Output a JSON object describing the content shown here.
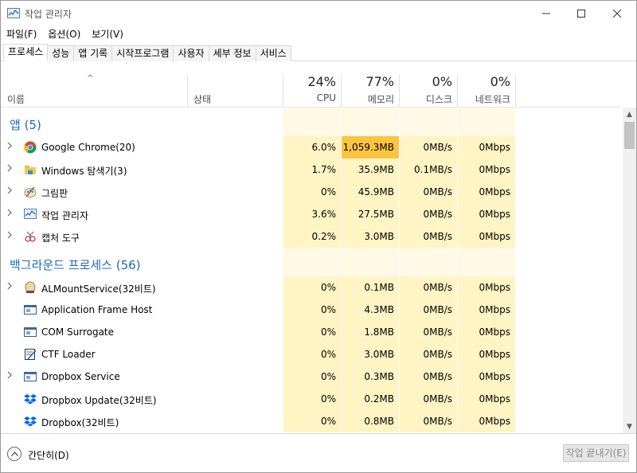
{
  "window": {
    "title": "작업 관리자",
    "controls": {
      "minimize": "—",
      "maximize": "☐",
      "close": "✕"
    }
  },
  "menu": [
    "파일(F)",
    "옵션(O)",
    "보기(V)"
  ],
  "tabs": [
    "프로세스",
    "성능",
    "앱 기록",
    "시작프로그램",
    "사용자",
    "세부 정보",
    "서비스"
  ],
  "active_tab": "프로세스",
  "columns": {
    "name": "이름",
    "status": "상태",
    "cpu": {
      "percent": "24%",
      "label": "CPU"
    },
    "memory": {
      "percent": "77%",
      "label": "메모리"
    },
    "disk": {
      "percent": "0%",
      "label": "디스크"
    },
    "network": {
      "percent": "0%",
      "label": "네트워크"
    }
  },
  "groups": [
    {
      "title": "앱 (5)",
      "rows": [
        {
          "name": "Google Chrome(20)",
          "icon": "chrome-icon",
          "expandable": true,
          "cpu": "6.0%",
          "memory": "1,059.3MB",
          "disk": "0MB/s",
          "network": "0Mbps",
          "memory_highlight": true
        },
        {
          "name": "Windows 탐색기(3)",
          "icon": "folder-icon",
          "expandable": true,
          "cpu": "1.7%",
          "memory": "35.9MB",
          "disk": "0.1MB/s",
          "network": "0Mbps"
        },
        {
          "name": "그림판",
          "icon": "paint-icon",
          "expandable": true,
          "cpu": "0%",
          "memory": "45.9MB",
          "disk": "0MB/s",
          "network": "0Mbps"
        },
        {
          "name": "작업 관리자",
          "icon": "task-manager-icon",
          "expandable": true,
          "cpu": "3.6%",
          "memory": "27.5MB",
          "disk": "0MB/s",
          "network": "0Mbps"
        },
        {
          "name": "캡처 도구",
          "icon": "snipping-tool-icon",
          "expandable": true,
          "cpu": "0.2%",
          "memory": "3.0MB",
          "disk": "0MB/s",
          "network": "0Mbps"
        }
      ]
    },
    {
      "title": "백그라운드 프로세스 (56)",
      "rows": [
        {
          "name": "ALMountService(32비트)",
          "icon": "almount-icon",
          "expandable": true,
          "cpu": "0%",
          "memory": "0.1MB",
          "disk": "0MB/s",
          "network": "0Mbps"
        },
        {
          "name": "Application Frame Host",
          "icon": "app-frame-icon",
          "expandable": false,
          "cpu": "0%",
          "memory": "4.3MB",
          "disk": "0MB/s",
          "network": "0Mbps"
        },
        {
          "name": "COM Surrogate",
          "icon": "app-frame-icon",
          "expandable": false,
          "cpu": "0%",
          "memory": "1.8MB",
          "disk": "0MB/s",
          "network": "0Mbps"
        },
        {
          "name": "CTF Loader",
          "icon": "ctf-icon",
          "expandable": false,
          "cpu": "0%",
          "memory": "3.0MB",
          "disk": "0MB/s",
          "network": "0Mbps"
        },
        {
          "name": "Dropbox Service",
          "icon": "app-frame-icon",
          "expandable": true,
          "cpu": "0%",
          "memory": "0.3MB",
          "disk": "0MB/s",
          "network": "0Mbps"
        },
        {
          "name": "Dropbox Update(32비트)",
          "icon": "dropbox-icon",
          "expandable": false,
          "cpu": "0%",
          "memory": "0.2MB",
          "disk": "0MB/s",
          "network": "0Mbps"
        },
        {
          "name": "Dropbox(32비트)",
          "icon": "dropbox-icon",
          "expandable": false,
          "cpu": "0%",
          "memory": "0.8MB",
          "disk": "0MB/s",
          "network": "0Mbps"
        }
      ]
    }
  ],
  "footer": {
    "fewer_details": "간단히(D)",
    "end_task": "작업 끝내기(E)"
  },
  "colors": {
    "heat_light": "#fff9e5",
    "heat_mid": "#fff4c4",
    "heat_high": "#fcc540",
    "group_title": "#1c6cb8"
  }
}
